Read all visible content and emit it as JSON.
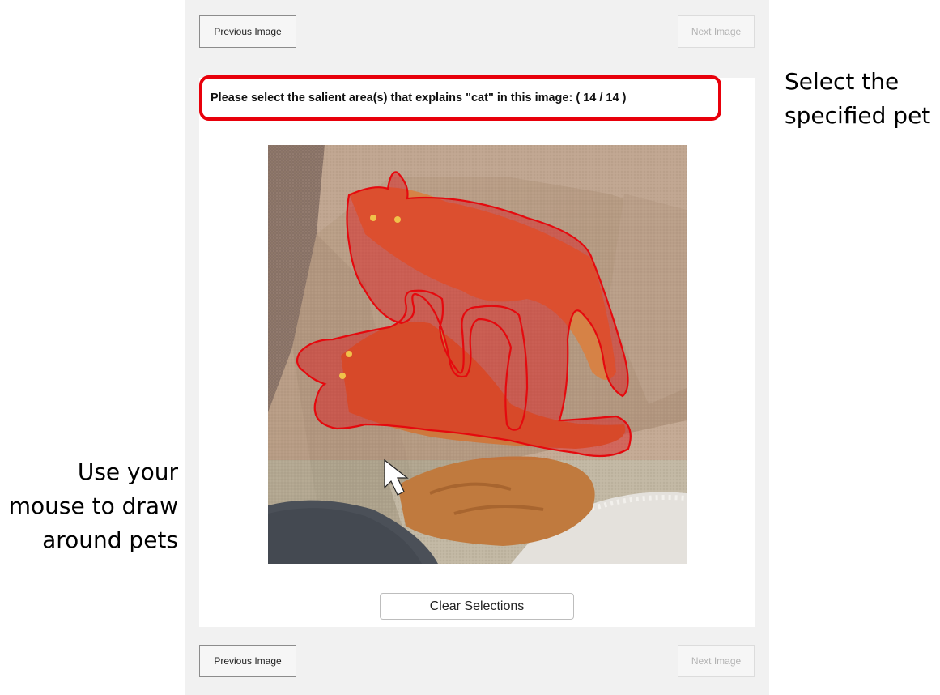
{
  "nav": {
    "previous_label": "Previous Image",
    "next_label": "Next Image"
  },
  "prompt": {
    "text": "Please select the salient area(s) that explains \"cat\" in this image: ( 14 / 14 )"
  },
  "image": {
    "subject": "two orange tabby cats on a beige couch cushion, upper region overlaid with red selection tint"
  },
  "selection": {
    "outline_color": "#e8000b",
    "fill_color": "#e8000b"
  },
  "actions": {
    "clear_label": "Clear Selections"
  },
  "annotations": {
    "left_lines": [
      "Use your",
      "mouse to draw",
      "around pets"
    ],
    "right_lines": [
      "Select the",
      "specified pet"
    ]
  }
}
